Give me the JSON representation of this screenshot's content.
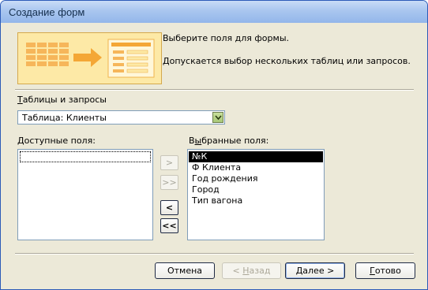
{
  "window": {
    "title": "Создание форм"
  },
  "header": {
    "line1": "Выберите поля для формы.",
    "line2": "Допускается выбор нескольких таблиц или запросов."
  },
  "tables": {
    "label_first": "Т",
    "label_rest": "аблицы и запросы",
    "selected": "Таблица: Клиенты"
  },
  "available": {
    "label_first": "Д",
    "label_rest": "оступные поля:",
    "items": []
  },
  "selected_fields": {
    "label_pre": "В",
    "label_ul": "ы",
    "label_rest": "бранные поля:",
    "items": [
      "№К",
      "Ф Клиента",
      "Год рождения",
      "Город",
      "Тип вагона"
    ]
  },
  "move_buttons": {
    "add": ">",
    "add_all": ">>",
    "remove": "<",
    "remove_all": "<<"
  },
  "footer": {
    "cancel": "Отмена",
    "back_ul": "Н",
    "back_pre": "< ",
    "back_rest": "азад",
    "next_ul": "Д",
    "next_rest": "алее >",
    "finish_ul": "Г",
    "finish_rest": "отово"
  },
  "colors": {
    "title_bar": "#a9c6ef",
    "dialog_bg": "#ece9d8",
    "banner": "#fde9a6",
    "selection": "#000000"
  }
}
